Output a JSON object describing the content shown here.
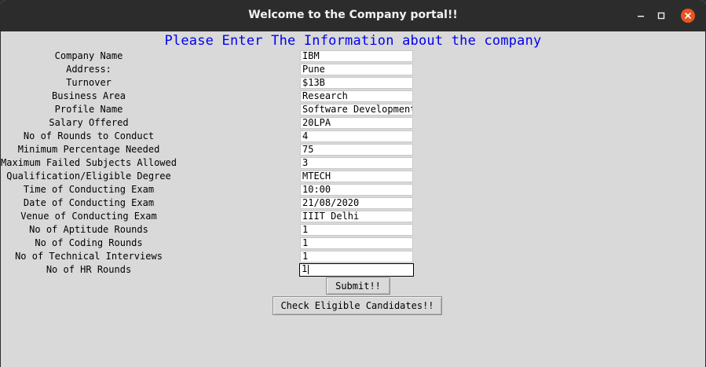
{
  "window": {
    "title": "Welcome to the Company portal!!",
    "controls": [
      "minimize-icon",
      "maximize-icon",
      "close-icon"
    ],
    "close_color": "#e95420"
  },
  "form": {
    "heading": "Please Enter The Information about the company",
    "heading_color": "#0000ee",
    "fields": [
      {
        "label": "Company Name",
        "value": "IBM"
      },
      {
        "label": "Address:",
        "value": "Pune"
      },
      {
        "label": "Turnover",
        "value": "$13B"
      },
      {
        "label": "Business Area",
        "value": "Research"
      },
      {
        "label": "Profile Name",
        "value": "Software Development"
      },
      {
        "label": "Salary Offered",
        "value": "20LPA"
      },
      {
        "label": "No of Rounds to Conduct",
        "value": "4"
      },
      {
        "label": "Minimum Percentage Needed",
        "value": "75"
      },
      {
        "label": "Maximum Failed Subjects Allowed",
        "value": "3"
      },
      {
        "label": "Qualification/Eligible Degree",
        "value": "MTECH"
      },
      {
        "label": "Time of Conducting Exam",
        "value": "10:00"
      },
      {
        "label": "Date of Conducting Exam",
        "value": "21/08/2020"
      },
      {
        "label": "Venue of Conducting Exam",
        "value": "IIIT Delhi"
      },
      {
        "label": "No of Aptitude Rounds",
        "value": "1"
      },
      {
        "label": "No of Coding Rounds",
        "value": "1"
      },
      {
        "label": "No of Technical Interviews",
        "value": "1"
      },
      {
        "label": "No of HR Rounds",
        "value": "1"
      }
    ],
    "submit_label": "Submit!!",
    "check_label": "Check Eligible Candidates!!"
  }
}
